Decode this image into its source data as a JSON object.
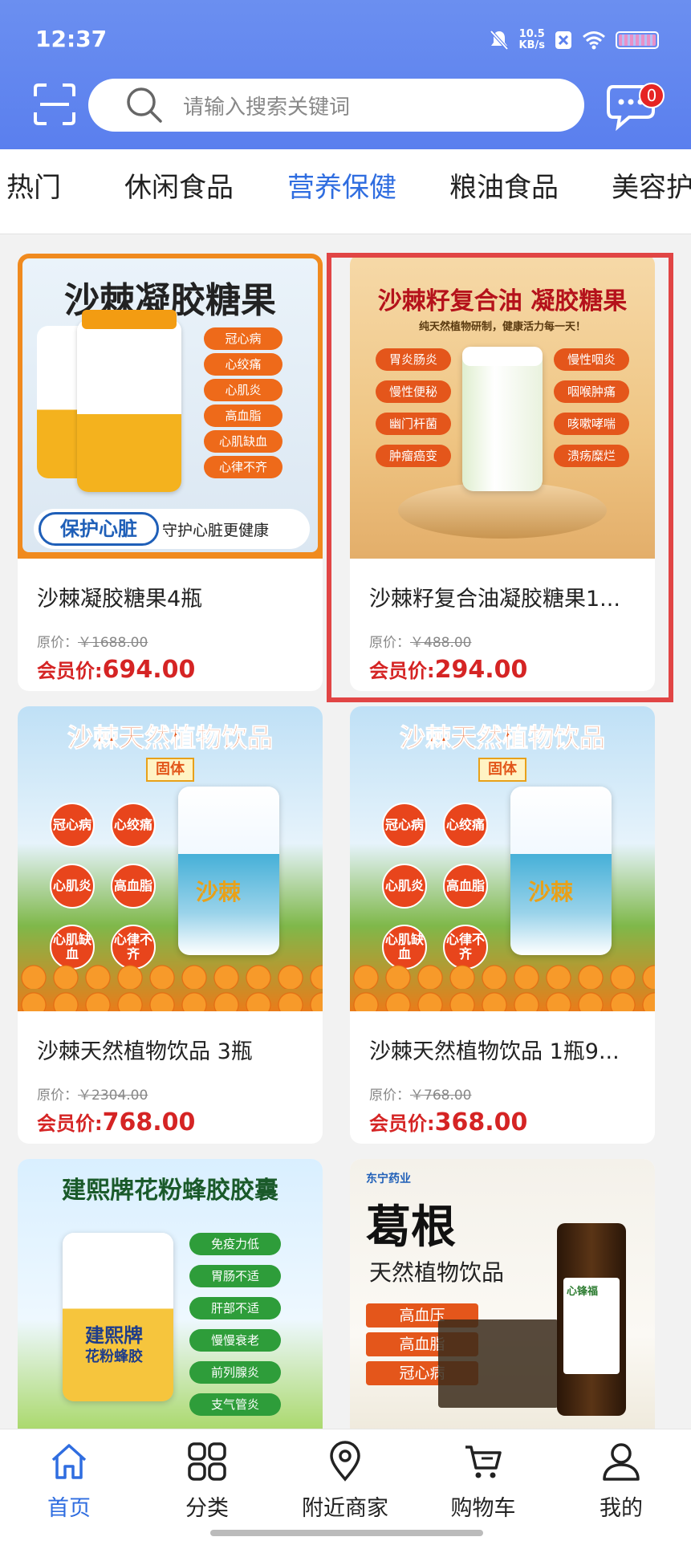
{
  "status_bar": {
    "time": "12:37",
    "net_speed_value": "10.5",
    "net_speed_unit": "KB/s"
  },
  "search": {
    "placeholder": "请输入搜索关键词"
  },
  "messages": {
    "badge_count": "0"
  },
  "category_tabs": [
    {
      "label": "热门",
      "active": false
    },
    {
      "label": "休闲食品",
      "active": false
    },
    {
      "label": "营养保健",
      "active": true
    },
    {
      "label": "粮油食品",
      "active": false
    },
    {
      "label": "美容护",
      "active": false
    }
  ],
  "products": [
    {
      "name": "沙棘凝胶糖果4瓶",
      "orig_label": "原价：",
      "orig_price": "￥1688.00",
      "member_label": "会员价:",
      "member_price": "694.00",
      "image": {
        "title": "沙棘凝胶糖果",
        "tags": [
          "冠心病",
          "心绞痛",
          "心肌炎",
          "高血脂",
          "心肌缺血",
          "心律不齐"
        ],
        "banner_main": "保护心脏",
        "banner_sub": "守护心脏更健康"
      }
    },
    {
      "name": "沙棘籽复合油凝胶糖果1...",
      "orig_label": "原价：",
      "orig_price": "￥488.00",
      "member_label": "会员价:",
      "member_price": "294.00",
      "image": {
        "title": "沙棘籽复合油 凝胶糖果",
        "subtitle": "纯天然植物研制，健康活力每一天！",
        "tags_left": [
          "胃炎肠炎",
          "慢性便秘",
          "幽门杆菌",
          "肿瘤癌变"
        ],
        "tags_right": [
          "慢性咽炎",
          "咽喉肿痛",
          "咳嗽哮喘",
          "溃疡糜烂"
        ]
      }
    },
    {
      "name": "沙棘天然植物饮品 3瓶",
      "orig_label": "原价：",
      "orig_price": "￥2304.00",
      "member_label": "会员价:",
      "member_price": "768.00",
      "image": {
        "title": "沙棘天然植物饮品",
        "badge": "固体",
        "tags": [
          "冠心病",
          "心绞痛",
          "心肌炎",
          "高血脂",
          "心肌缺血",
          "心律不齐"
        ],
        "jar_label": "沙棘"
      }
    },
    {
      "name": "沙棘天然植物饮品 1瓶9...",
      "orig_label": "原价：",
      "orig_price": "￥768.00",
      "member_label": "会员价:",
      "member_price": "368.00",
      "image": {
        "title": "沙棘天然植物饮品",
        "badge": "固体",
        "tags": [
          "冠心病",
          "心绞痛",
          "心肌炎",
          "高血脂",
          "心肌缺血",
          "心律不齐"
        ],
        "jar_label": "沙棘"
      }
    },
    {
      "image": {
        "title": "建熙牌花粉蜂胶胶囊",
        "tags": [
          "免疫力低",
          "胃肠不适",
          "肝部不适",
          "慢慢衰老",
          "前列腺炎",
          "支气管炎"
        ],
        "jar_label": "建熙牌",
        "jar_sub": "花粉蜂胶"
      }
    },
    {
      "image": {
        "brand": "东宁药业",
        "title": "葛根",
        "subtitle": "天然植物饮品",
        "tags": [
          "高血压",
          "高血脂",
          "冠心病"
        ],
        "bottle_label": "心锋福"
      }
    }
  ],
  "bottom_nav": [
    {
      "label": "首页",
      "icon": "home-icon",
      "active": true
    },
    {
      "label": "分类",
      "icon": "category-grid-icon",
      "active": false
    },
    {
      "label": "附近商家",
      "icon": "location-pin-icon",
      "active": false
    },
    {
      "label": "购物车",
      "icon": "cart-icon",
      "active": false
    },
    {
      "label": "我的",
      "icon": "profile-icon",
      "active": false
    }
  ],
  "colors": {
    "header": "#5a7fee",
    "accent_blue": "#2f6de0",
    "price_red": "#d52424",
    "selection_frame": "#e14545"
  }
}
